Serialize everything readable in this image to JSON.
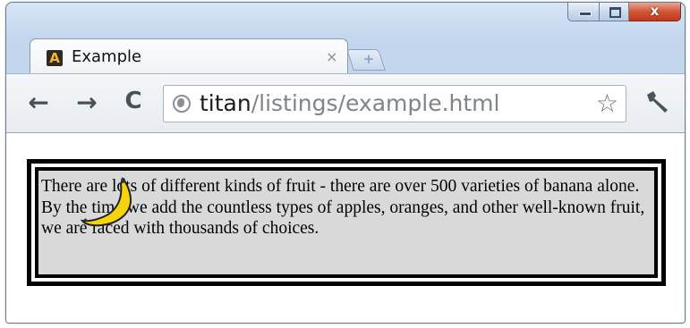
{
  "browser": {
    "tab": {
      "title": "Example",
      "favicon_letter": "A",
      "close_glyph": "×"
    },
    "new_tab_glyph": "+",
    "window_controls": {
      "close_glyph": "x"
    },
    "nav": {
      "back": "←",
      "forward": "→",
      "reload": "C"
    },
    "address": {
      "host": "titan",
      "path": "/listings/example.html"
    },
    "bookmark_glyph": "☆"
  },
  "page": {
    "paragraph": "There are lots of different kinds of fruit - there are over 500 varieties of banana alone. By the time we add the countless types of apples, oranges, and other well-known fruit, we are faced with thousands of choices."
  },
  "colors": {
    "window_frame": "#c3d6ee",
    "close_button": "#d2553a",
    "paragraph_background": "#d9d9d9",
    "border": "#000000",
    "banana": "#f5d40c"
  }
}
